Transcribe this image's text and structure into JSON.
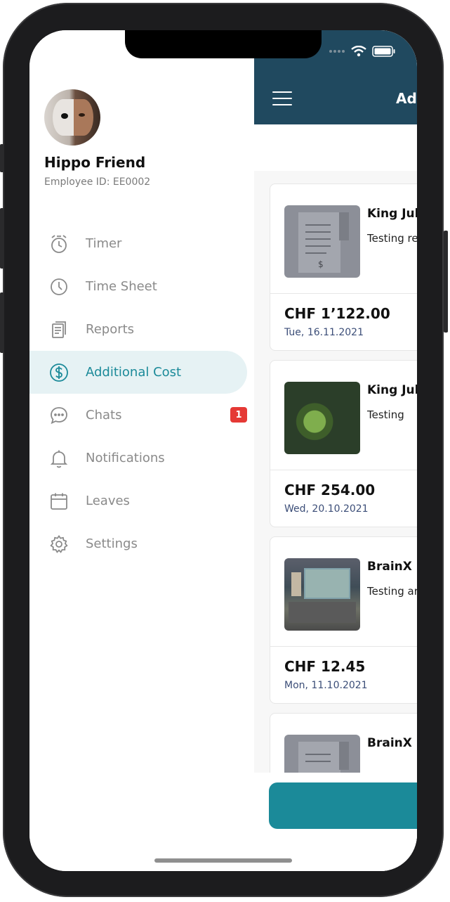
{
  "profile": {
    "name": "Hippo Friend",
    "employee_id": "Employee ID: EE0002"
  },
  "menu": {
    "items": [
      {
        "label": "Timer",
        "icon": "stopwatch-icon"
      },
      {
        "label": "Time Sheet",
        "icon": "clock-icon"
      },
      {
        "label": "Reports",
        "icon": "document-icon"
      },
      {
        "label": "Additional Cost",
        "icon": "dollar-circle-icon",
        "active": true
      },
      {
        "label": "Chats",
        "icon": "chat-bubble-icon",
        "badge": "1"
      },
      {
        "label": "Notifications",
        "icon": "bell-icon"
      },
      {
        "label": "Leaves",
        "icon": "calendar-icon"
      },
      {
        "label": "Settings",
        "icon": "gear-icon"
      }
    ]
  },
  "header": {
    "title": "Ad"
  },
  "cards": [
    {
      "title": "King Jul",
      "desc": "Testing re",
      "amount": "CHF 1’122.00",
      "date": "Tue, 16.11.2021",
      "thumb": "receipt"
    },
    {
      "title": "King Jul",
      "desc": "Testing",
      "amount": "CHF 254.00",
      "date": "Wed, 20.10.2021",
      "thumb": "plant"
    },
    {
      "title": "BrainX",
      "desc": "Testing ar",
      "amount": "CHF 12.45",
      "date": "Mon, 11.10.2021",
      "thumb": "desk"
    },
    {
      "title": "BrainX",
      "desc": "",
      "amount": "",
      "date": "",
      "thumb": "receipt"
    }
  ],
  "colors": {
    "accent": "#1b8a99",
    "header": "#20495f",
    "badge": "#e53935",
    "active_bg": "#e6f2f4",
    "date_text": "#3c4e78"
  }
}
